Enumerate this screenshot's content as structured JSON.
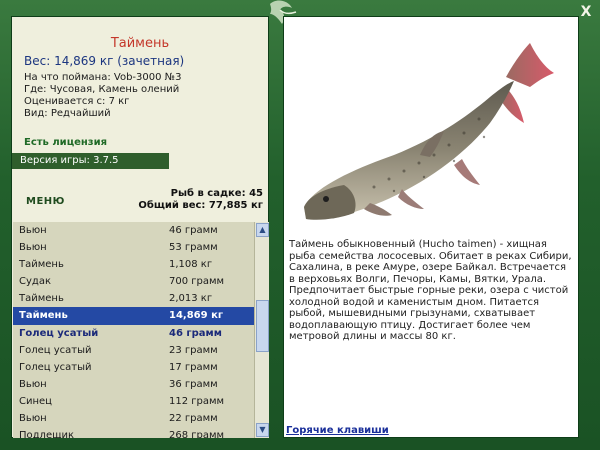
{
  "window": {
    "close_label": "X"
  },
  "fish": {
    "name": "Таймень",
    "weight": "Вес: 14,869 кг (зачетная)",
    "caught_with": "На что поймана: Vob-3000 №3",
    "location": "Где: Чусовая, Камень олений",
    "valued_from": "Оценивается с: 7 кг",
    "rarity": "Вид: Редчайший",
    "description": "Таймень обыкновенный (Hucho taimen) - хищная рыба семейства лососевых. Обитает в реках Сибири, Сахалина, в реке Амуре, озере Байкал. Встречается в верховьях Волги, Печоры, Камы, Вятки, Урала. Предпочитает быстрые горные реки, озера с чистой холодной водой и каменистым дном. Питается рыбой, мышевидными грызунами, схватывает водоплавающую птицу. Достигает более чем метровой длины и массы 80 кг."
  },
  "status": {
    "license": "Есть лицензия",
    "version": "Версия игры: 3.7.5"
  },
  "menu": {
    "label": "МЕНЮ"
  },
  "stats": {
    "fish_in_cage": "Рыб в садке: 45",
    "total_weight": "Общий вес: 77,885 кг"
  },
  "fish_list": [
    {
      "name": "Вьюн",
      "weight": "46 грамм",
      "state": "normal"
    },
    {
      "name": "Вьюн",
      "weight": "53 грамм",
      "state": "normal"
    },
    {
      "name": "Таймень",
      "weight": "1,108 кг",
      "state": "normal"
    },
    {
      "name": "Судак",
      "weight": "700 грамм",
      "state": "normal"
    },
    {
      "name": "Таймень",
      "weight": "2,013 кг",
      "state": "normal"
    },
    {
      "name": "Таймень",
      "weight": "14,869 кг",
      "state": "selected"
    },
    {
      "name": "Голец усатый",
      "weight": "46 грамм",
      "state": "bold"
    },
    {
      "name": "Голец усатый",
      "weight": "23 грамм",
      "state": "normal"
    },
    {
      "name": "Голец усатый",
      "weight": "17 грамм",
      "state": "normal"
    },
    {
      "name": "Вьюн",
      "weight": "36 грамм",
      "state": "normal"
    },
    {
      "name": "Синец",
      "weight": "112 грамм",
      "state": "normal"
    },
    {
      "name": "Вьюн",
      "weight": "22 грамм",
      "state": "normal"
    },
    {
      "name": "Подлещик",
      "weight": "268 грамм",
      "state": "normal"
    }
  ],
  "links": {
    "hotkeys": "Горячие клавиши"
  },
  "colors": {
    "frame": "#22602c",
    "panel": "#efefdd",
    "selected": "#2449a4",
    "fish_name": "#c4372a",
    "weight_text": "#1c3680"
  },
  "icons": {
    "close": "close-icon",
    "scroll_up": "arrow-up-icon",
    "scroll_down": "arrow-down-icon",
    "ornament": "leaf-ornament-icon"
  }
}
